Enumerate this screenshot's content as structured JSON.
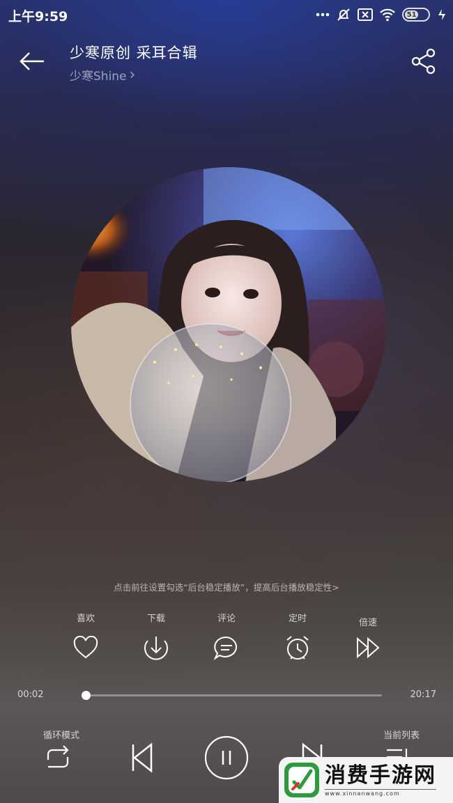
{
  "status_bar": {
    "time": "上午9:59",
    "battery_level": "51",
    "icons": [
      "more-dots-icon",
      "alarm-off-icon",
      "sim-icon",
      "wifi-icon",
      "battery-icon",
      "charging-icon"
    ]
  },
  "header": {
    "back_icon": "arrow-left-icon",
    "title": "少寒原创 采耳合辑",
    "artist": "少寒Shine",
    "artist_chevron": "›",
    "share_icon": "share-icon"
  },
  "tip": "点击前往设置勾选“后台稳定播放”，提高后台播放稳定性>",
  "actions": [
    {
      "label": "喜欢",
      "icon": "heart-icon"
    },
    {
      "label": "下载",
      "icon": "download-icon"
    },
    {
      "label": "评论",
      "icon": "comment-icon"
    },
    {
      "label": "定时",
      "icon": "alarm-clock-icon"
    },
    {
      "label": "倍速",
      "icon": "speed-icon"
    }
  ],
  "progress": {
    "current": "00:02",
    "total": "20:17",
    "fraction": 0.002
  },
  "controls": {
    "loop_label": "循环模式",
    "playlist_label": "当前列表",
    "loop_icon": "repeat-icon",
    "prev_icon": "previous-icon",
    "play_pause_icon": "pause-icon",
    "next_icon": "next-icon",
    "playlist_icon": "playlist-icon"
  },
  "watermark": {
    "title": "消费手游网",
    "url": "www.xinnanwang.com"
  },
  "colors": {
    "text": "#ffffff",
    "muted": "#9a9aa6",
    "watermark_green": "#2e9a3e"
  }
}
